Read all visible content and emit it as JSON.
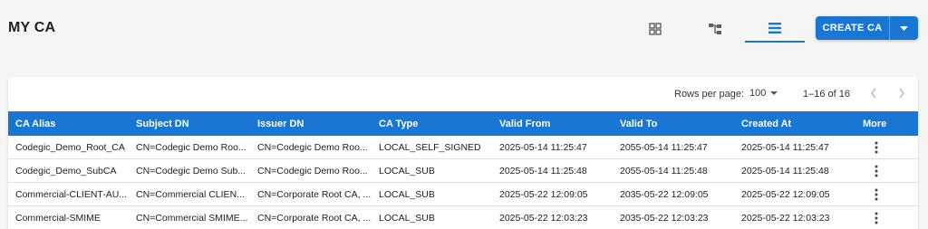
{
  "page": {
    "title": "MY CA"
  },
  "toolbar": {
    "views": [
      {
        "name": "grid-view",
        "icon": "grid-icon"
      },
      {
        "name": "tree-view",
        "icon": "tree-icon"
      },
      {
        "name": "list-view",
        "icon": "list-icon",
        "active": true
      }
    ],
    "create_label": "CREATE CA",
    "accent_color": "#1976d2"
  },
  "pager": {
    "rows_per_page_label": "Rows per page:",
    "rows_per_page_value": "100",
    "range": "1–16 of 16"
  },
  "table": {
    "columns": [
      "CA Alias",
      "Subject DN",
      "Issuer DN",
      "CA Type",
      "Valid From",
      "Valid To",
      "Created At",
      "More"
    ],
    "rows": [
      [
        "Codegic_Demo_Root_CA",
        "CN=Codegic Demo Roo...",
        "CN=Codegic Demo Roo...",
        "LOCAL_SELF_SIGNED",
        "2025-05-14 11:25:47",
        "2055-05-14 11:25:47",
        "2025-05-14 11:25:47"
      ],
      [
        "Codegic_Demo_SubCA",
        "CN=Codegic Demo Sub...",
        "CN=Codegic Demo Roo...",
        "LOCAL_SUB",
        "2025-05-14 11:25:48",
        "2055-05-14 11:25:48",
        "2025-05-14 11:25:48"
      ],
      [
        "Commercial-CLIENT-AU...",
        "CN=Commercial CLIEN...",
        "CN=Corporate Root CA, ...",
        "LOCAL_SUB",
        "2025-05-22 12:09:05",
        "2035-05-22 12:09:05",
        "2025-05-22 12:09:05"
      ],
      [
        "Commercial-SMIME",
        "CN=Commercial SMIME...",
        "CN=Corporate Root CA, ...",
        "LOCAL_SUB",
        "2025-05-22 12:03:23",
        "2035-05-22 12:03:23",
        "2025-05-22 12:03:23"
      ]
    ]
  }
}
